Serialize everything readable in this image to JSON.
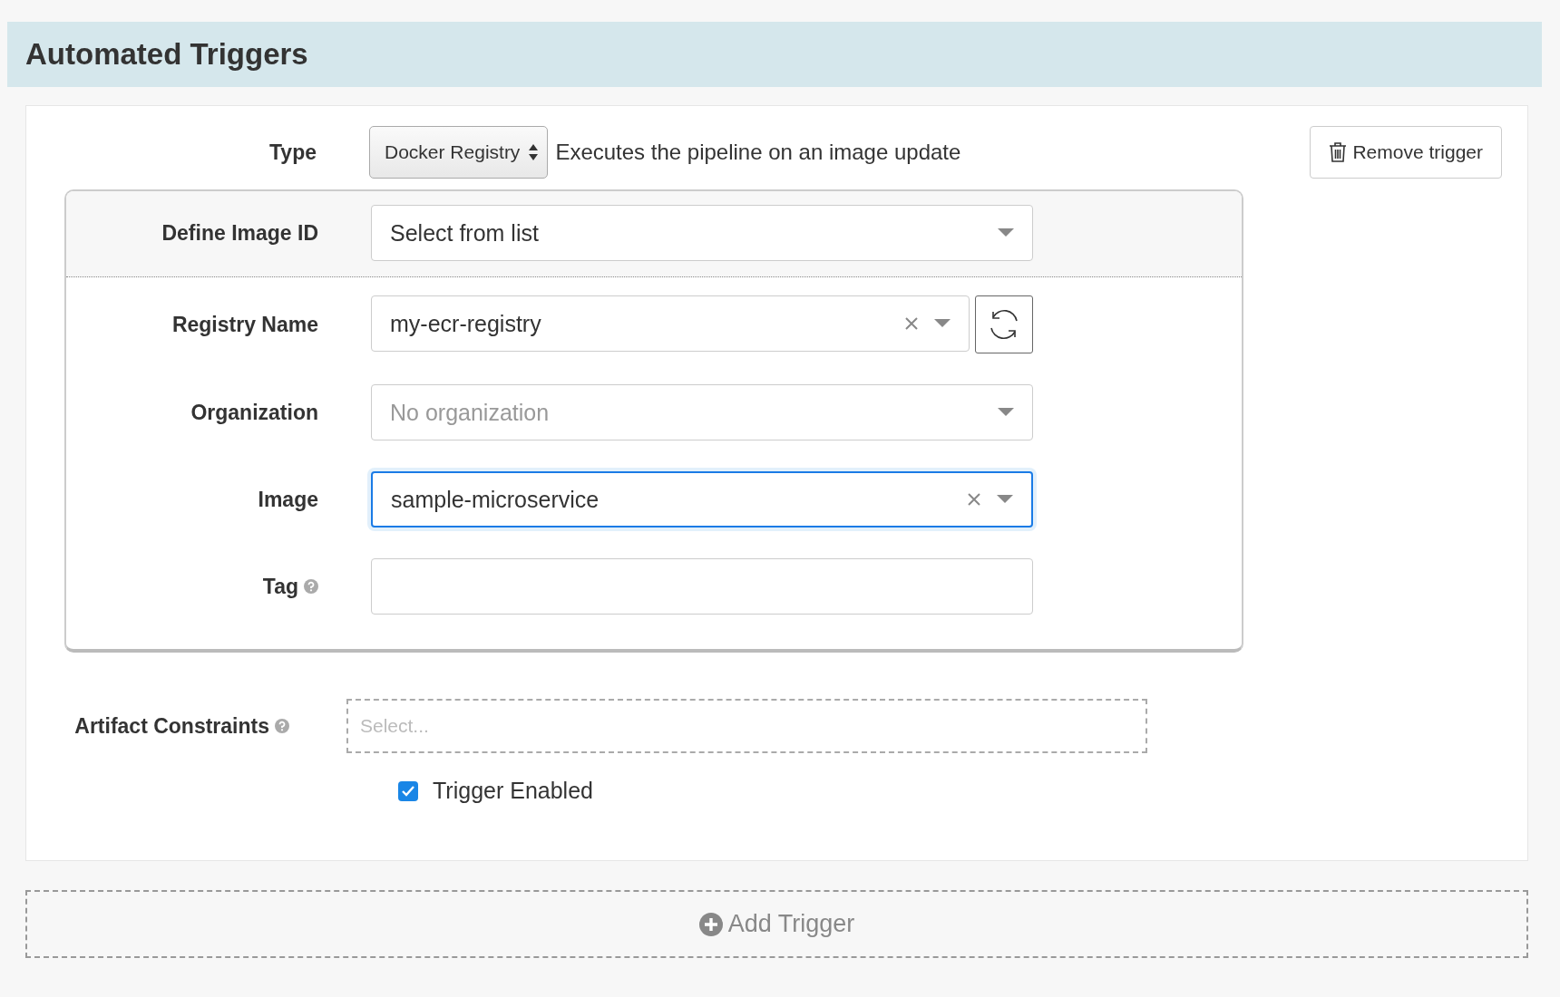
{
  "section": {
    "title": "Automated Triggers"
  },
  "trigger": {
    "type": {
      "label": "Type",
      "value": "Docker Registry",
      "description": "Executes the pipeline on an image update"
    },
    "remove_button": "Remove trigger",
    "image_id": {
      "label": "Define Image ID",
      "value": "Select from list"
    },
    "fields": [
      {
        "label": "Registry Name",
        "kind": "select",
        "value": "my-ecr-registry",
        "clearable": true,
        "refresh_button": true,
        "focused": false,
        "help": false
      },
      {
        "label": "Organization",
        "kind": "select",
        "placeholder": "No organization",
        "clearable": false,
        "refresh_button": false,
        "focused": false,
        "help": false
      },
      {
        "label": "Image",
        "kind": "select",
        "value": "sample-microservice",
        "clearable": true,
        "refresh_button": false,
        "focused": true,
        "help": false
      },
      {
        "label": "Tag",
        "kind": "text",
        "clearable": false,
        "refresh_button": false,
        "focused": false,
        "help": true
      }
    ],
    "artifact_constraints": {
      "label": "Artifact Constraints",
      "placeholder": "Select...",
      "help": true
    },
    "enabled": {
      "label": "Trigger Enabled",
      "checked": true
    }
  },
  "add_button": "Add Trigger"
}
